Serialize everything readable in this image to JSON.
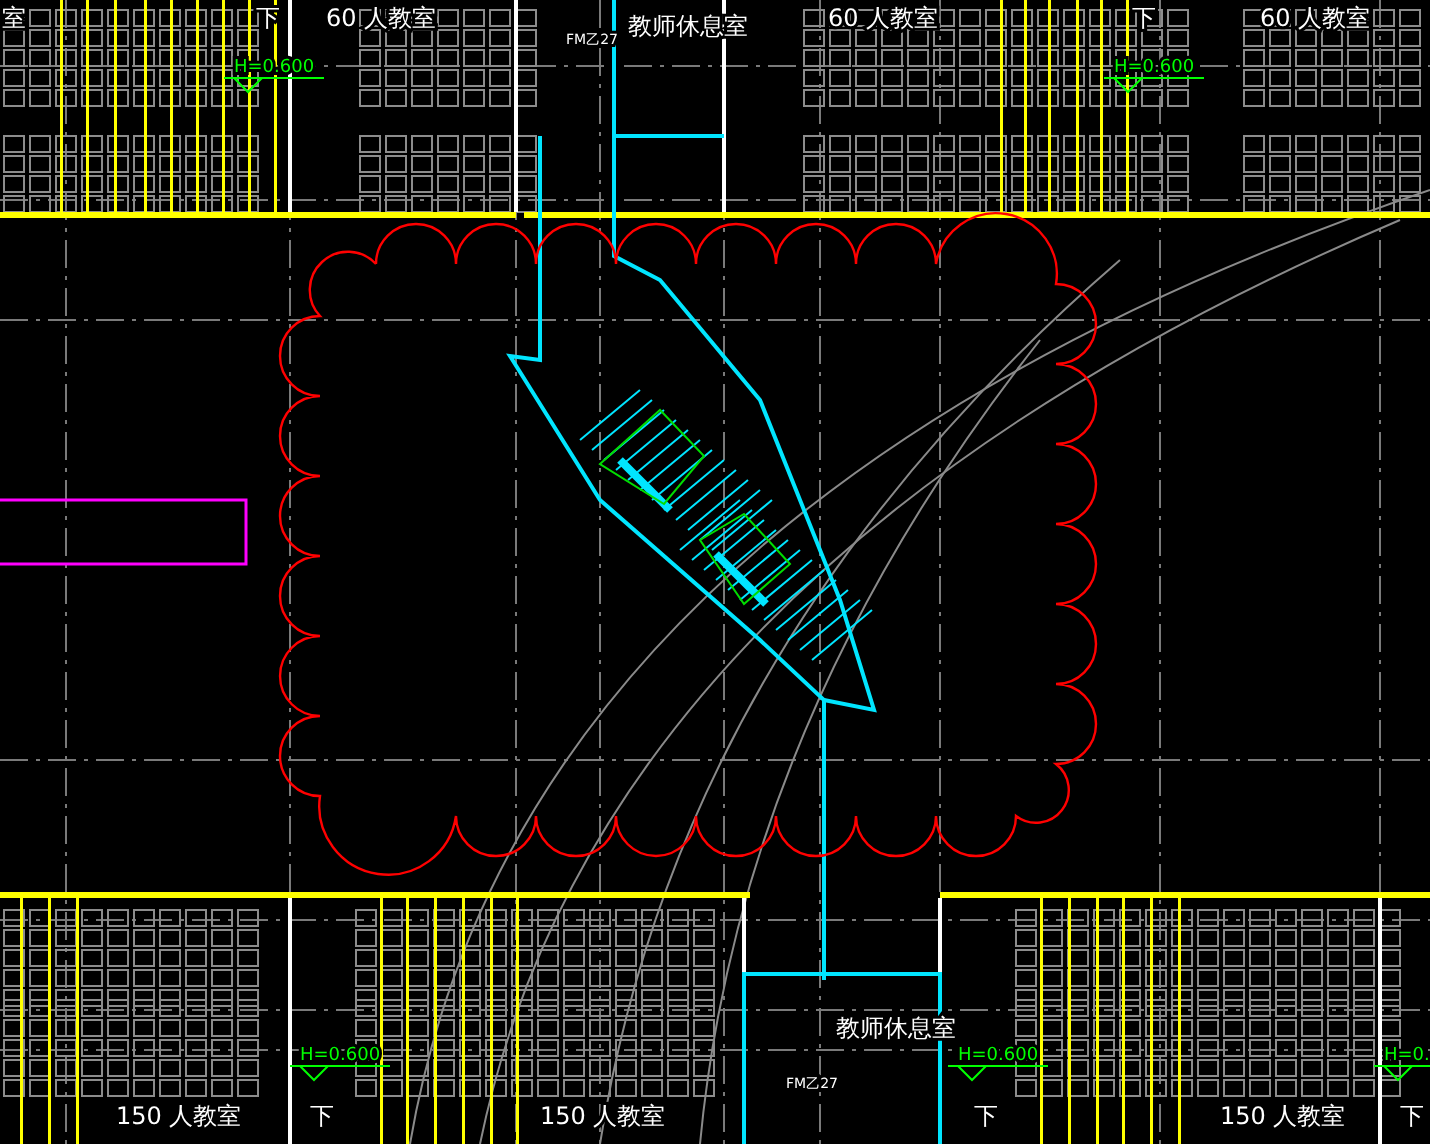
{
  "labels": [
    {
      "text": "室",
      "kind": "room"
    },
    {
      "text": "下",
      "kind": "stair"
    },
    {
      "text": "60 人教室",
      "kind": "room"
    },
    {
      "text": "FM乙27",
      "kind": "door"
    },
    {
      "text": "教师休息室",
      "kind": "room"
    },
    {
      "text": "60 人教室",
      "kind": "room"
    },
    {
      "text": "下",
      "kind": "stair"
    },
    {
      "text": "60 人教室",
      "kind": "room"
    },
    {
      "text": "H=0.600",
      "kind": "elevation"
    },
    {
      "text": "H=0.600",
      "kind": "elevation"
    },
    {
      "text": "H=0.600",
      "kind": "elevation"
    },
    {
      "text": "H=0.600",
      "kind": "elevation"
    },
    {
      "text": "H=0.",
      "kind": "elevation"
    },
    {
      "text": "教师休息室",
      "kind": "room"
    },
    {
      "text": "FM乙27",
      "kind": "door"
    },
    {
      "text": "150 人教室",
      "kind": "room"
    },
    {
      "text": "下",
      "kind": "stair"
    },
    {
      "text": "150 人教室",
      "kind": "room"
    },
    {
      "text": "下",
      "kind": "stair"
    },
    {
      "text": "150 人教室",
      "kind": "room"
    },
    {
      "text": "下",
      "kind": "stair"
    }
  ]
}
